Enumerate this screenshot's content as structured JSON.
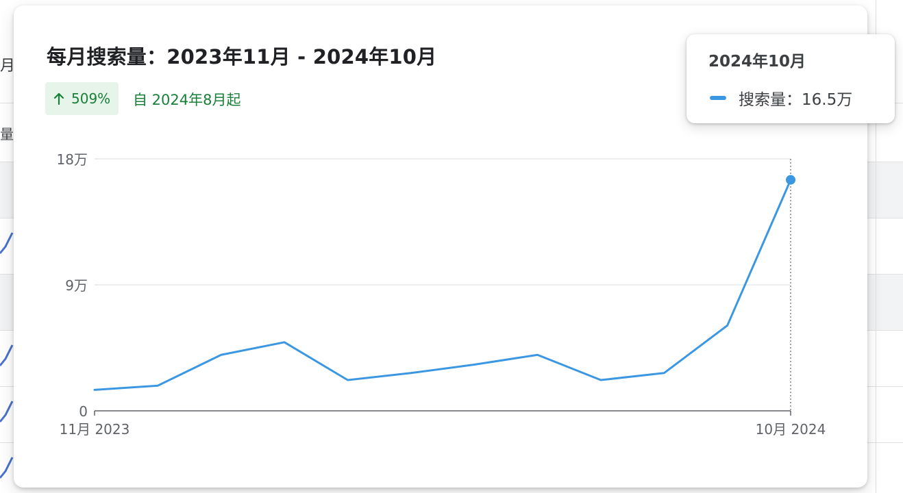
{
  "background": {
    "partial_texts": [
      "月",
      "量"
    ]
  },
  "card": {
    "title": "每月搜索量：2023年11月 - 2024年10月",
    "trend": {
      "icon": "arrow-up-icon",
      "percent": "509%",
      "since": "自 2024年8月起"
    }
  },
  "tooltip": {
    "title": "2024年10月",
    "label": "搜索量：16.5万"
  },
  "colors": {
    "line": "#3c97e2",
    "trend_green": "#188038",
    "trend_bg": "#e6f4ea"
  },
  "chart_data": {
    "type": "line",
    "title": "",
    "xlabel": "",
    "ylabel": "",
    "x": [
      "2023-11",
      "2023-12",
      "2024-01",
      "2024-02",
      "2024-03",
      "2024-04",
      "2024-05",
      "2024-06",
      "2024-07",
      "2024-08",
      "2024-09",
      "2024-10"
    ],
    "x_tick_labels": [
      {
        "x": "2023-11",
        "label": "11月 2023"
      },
      {
        "x": "2024-10",
        "label": "10月 2024"
      }
    ],
    "ylim": [
      0,
      180000
    ],
    "y_ticks": [
      {
        "value": 0,
        "label": "0"
      },
      {
        "value": 90000,
        "label": "9万"
      },
      {
        "value": 180000,
        "label": "18万"
      }
    ],
    "series": [
      {
        "values": [
          15000,
          18000,
          40000,
          49000,
          22000,
          27000,
          33000,
          40000,
          22000,
          27000,
          61000,
          165000
        ]
      }
    ],
    "highlight": {
      "x": "2024-10",
      "value": 165000
    },
    "grid": true,
    "legend": "none"
  }
}
